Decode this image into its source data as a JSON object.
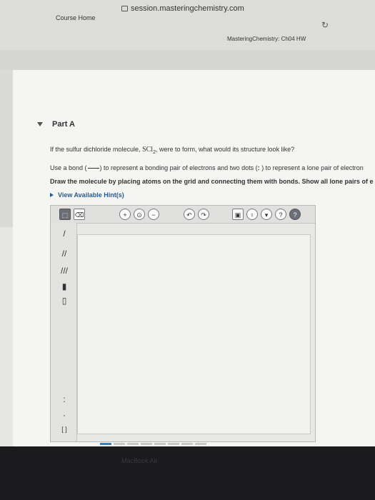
{
  "browser": {
    "url": "session.masteringchemistry.com",
    "course_home": "Course Home",
    "tab_title": "MasteringChemistry: Ch04 HW",
    "reload_icon": "reload-icon"
  },
  "part": {
    "label": "Part A"
  },
  "question": {
    "line1_pre": "If the sulfur dichloride molecule, ",
    "formula": "SCl",
    "formula_sub": "2",
    "line1_post": ", were to form, what would its structure look like?",
    "line2_pre": "Use a bond (",
    "line2_mid": ") to represent a bonding pair of electrons and two dots (",
    "line2_dots": ":",
    "line2_post": ") to represent a lone pair of electron",
    "line3": "Draw the molecule by placing atoms on the grid and connecting them with bonds. Show all lone pairs of e"
  },
  "hint": {
    "label": "View Available Hint(s)"
  },
  "toolbar": {
    "zoom_in": "+",
    "zoom_fit": "⊙",
    "zoom_out": "−",
    "undo": "↶",
    "redo": "↷",
    "image": "▣",
    "light": "♀",
    "down": "▾",
    "info": "?",
    "help": "?"
  },
  "left_tools": {
    "single_bond": "/",
    "double_bond": "//",
    "triple_bond": "///",
    "wedge_bond": "▮",
    "dash_bond": "▯",
    "lone_pair": ":",
    "radical": "·",
    "bracket": "[ ]"
  },
  "bezel": {
    "text": "MacBook Air"
  }
}
